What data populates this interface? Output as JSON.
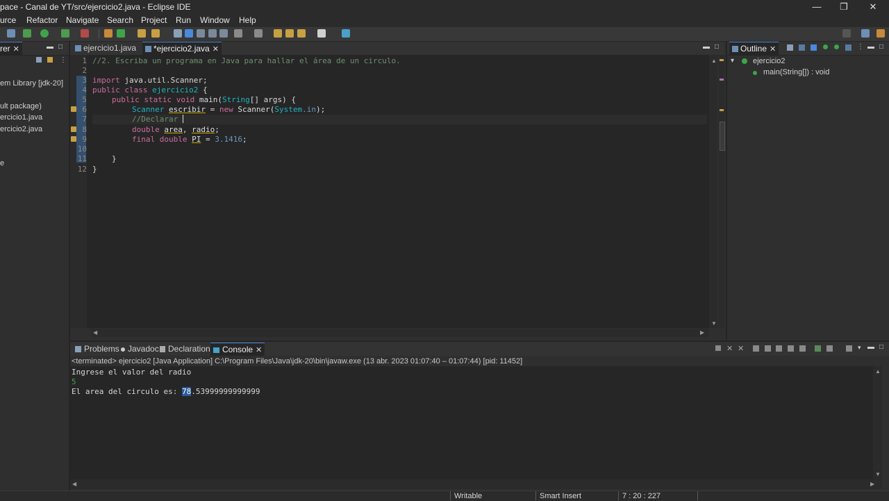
{
  "window": {
    "title": "pace - Canal de YT/src/ejercicio2.java - Eclipse IDE",
    "minimize": "—",
    "restore": "❐",
    "close": "✕"
  },
  "menu": [
    "urce",
    "Refactor",
    "Navigate",
    "Search",
    "Project",
    "Run",
    "Window",
    "Help"
  ],
  "explorer": {
    "tab_label": "rer",
    "items": [
      "em Library [jdk-20]",
      "ult package)",
      "ercicio1.java",
      "ercicio2.java",
      "e"
    ]
  },
  "editor": {
    "tabs": [
      {
        "label": "ejercicio1.java"
      },
      {
        "label": "*ejercicio2.java"
      }
    ],
    "line_numbers": [
      "1",
      "2",
      "3",
      "4",
      "5",
      "6",
      "7",
      "8",
      "9",
      "10",
      "11",
      "12"
    ],
    "lines": {
      "l1": "//2. Escriba un programa en Java para hallar el área de un circulo.",
      "l3_kw": "import",
      "l3_rest": " java.util.Scanner;",
      "l4_kw": "public class",
      "l4_cls": " ejercicio2",
      "l4_rest": " {",
      "l5_kw": "public static void",
      "l5_m": " main(",
      "l5_ty": "String",
      "l5_rest": "[] args) {",
      "l6_ty": "Scanner",
      "l6_var": "escribir",
      "l6_eq": " = ",
      "l6_kw": "new",
      "l6_cls": " Scanner(",
      "l6_sys": "System",
      "l6_in": ".in",
      "l6_end": ");",
      "l7": "//Declarar ",
      "l8_kw": "double",
      "l8_a": "area",
      "l8_comma": ", ",
      "l8_r": "radio",
      "l8_end": ";",
      "l9_kw": "final double",
      "l9_pi": "PI",
      "l9_eq": " = ",
      "l9_num": "3.1416",
      "l9_end": ";",
      "l11": "}",
      "l12": "}"
    }
  },
  "outline": {
    "tab_label": "Outline",
    "class_name": "ejercicio2",
    "method": "main(String[]) : void"
  },
  "bottom": {
    "tabs": [
      "Problems",
      "Javadoc",
      "Declaration",
      "Console"
    ],
    "terminated": "<terminated> ejercicio2 [Java Application] C:\\Program Files\\Java\\jdk-20\\bin\\javaw.exe  (13 abr. 2023 01:07:40 – 01:07:44) [pid: 11452]",
    "output_line1": "Ingrese el valor del radio",
    "output_input": "5",
    "output_line3_prefix": "El area del circulo es: ",
    "output_line3_sel": "78",
    "output_line3_rest": ".53999999999999"
  },
  "status": {
    "writable": "Writable",
    "insert": "Smart Insert",
    "position": "7 : 20 : 227"
  },
  "colors": {
    "accent": "#4a89dc",
    "keyword": "#cc6c9c",
    "type": "#1eb3c0",
    "comment": "#6f8f6f"
  }
}
